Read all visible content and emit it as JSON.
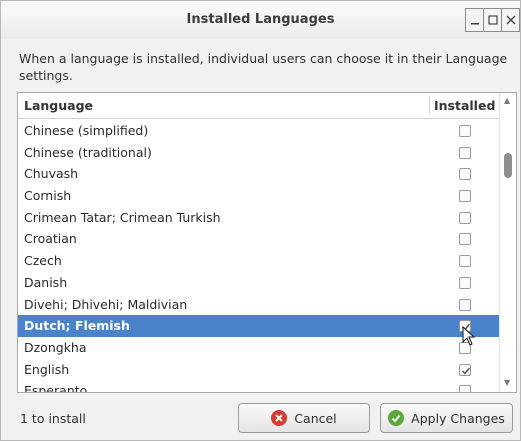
{
  "window": {
    "title": "Installed Languages",
    "controls": [
      "minimize",
      "maximize",
      "close"
    ]
  },
  "description": "When a language is installed, individual users can choose it in their Language settings.",
  "list": {
    "columns": {
      "language": "Language",
      "installed": "Installed"
    },
    "rows": [
      {
        "name": "Chinese (simplified)",
        "installed": false,
        "selected": false
      },
      {
        "name": "Chinese (traditional)",
        "installed": false,
        "selected": false
      },
      {
        "name": "Chuvash",
        "installed": false,
        "selected": false
      },
      {
        "name": "Cornish",
        "installed": false,
        "selected": false
      },
      {
        "name": "Crimean Tatar; Crimean Turkish",
        "installed": false,
        "selected": false
      },
      {
        "name": "Croatian",
        "installed": false,
        "selected": false
      },
      {
        "name": "Czech",
        "installed": false,
        "selected": false
      },
      {
        "name": "Danish",
        "installed": false,
        "selected": false
      },
      {
        "name": "Divehi; Dhivehi; Maldivian",
        "installed": false,
        "selected": false
      },
      {
        "name": "Dutch; Flemish",
        "installed": true,
        "selected": true
      },
      {
        "name": "Dzongkha",
        "installed": false,
        "selected": false
      },
      {
        "name": "English",
        "installed": true,
        "selected": false
      },
      {
        "name": "Esperanto",
        "installed": false,
        "selected": false
      }
    ]
  },
  "footer": {
    "status": "1 to install",
    "cancel_label": "Cancel",
    "apply_label": "Apply Changes"
  },
  "colors": {
    "selection": "#4a83c9",
    "cancel_icon": "#d63a2e",
    "apply_icon": "#5aaa3a"
  },
  "icons": {
    "cancel": "cancel-icon",
    "apply": "checkmark-icon",
    "pointer": "mouse-pointer-icon"
  }
}
